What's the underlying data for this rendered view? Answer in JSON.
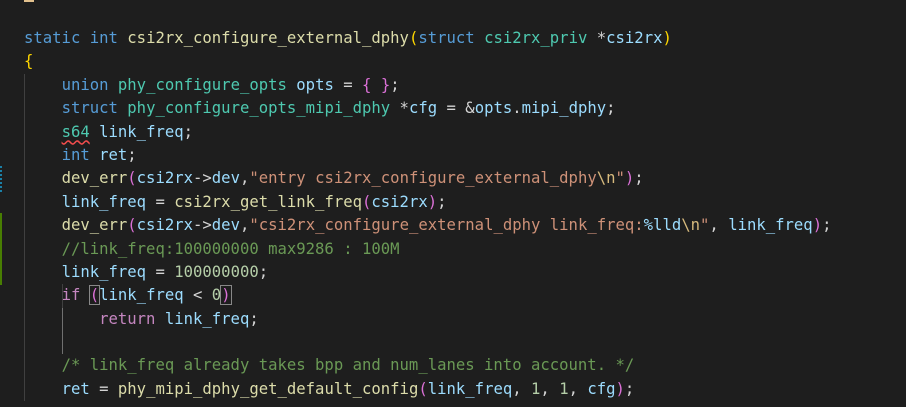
{
  "editor": {
    "lines": [
      [
        {
          "t": "static",
          "c": "kw"
        },
        {
          "t": " "
        },
        {
          "t": "int",
          "c": "kw"
        },
        {
          "t": " "
        },
        {
          "t": "csi2rx_configure_external_dphy",
          "c": "fn"
        },
        {
          "t": "(",
          "c": "bracket1"
        },
        {
          "t": "struct",
          "c": "kw"
        },
        {
          "t": " "
        },
        {
          "t": "csi2rx_priv",
          "c": "ty"
        },
        {
          "t": " *"
        },
        {
          "t": "csi2rx",
          "c": "var"
        },
        {
          "t": ")",
          "c": "bracket1"
        }
      ],
      [
        {
          "t": "{",
          "c": "bracket1"
        }
      ],
      [
        {
          "t": "    "
        },
        {
          "t": "union",
          "c": "kw"
        },
        {
          "t": " "
        },
        {
          "t": "phy_configure_opts",
          "c": "ty"
        },
        {
          "t": " "
        },
        {
          "t": "opts",
          "c": "var"
        },
        {
          "t": " = "
        },
        {
          "t": "{",
          "c": "bracket2"
        },
        {
          "t": " "
        },
        {
          "t": "}",
          "c": "bracket2"
        },
        {
          "t": ";"
        }
      ],
      [
        {
          "t": "    "
        },
        {
          "t": "struct",
          "c": "kw"
        },
        {
          "t": " "
        },
        {
          "t": "phy_configure_opts_mipi_dphy",
          "c": "ty"
        },
        {
          "t": " *"
        },
        {
          "t": "cfg",
          "c": "var"
        },
        {
          "t": " = &"
        },
        {
          "t": "opts",
          "c": "var"
        },
        {
          "t": "."
        },
        {
          "t": "mipi_dphy",
          "c": "var"
        },
        {
          "t": ";"
        }
      ],
      [
        {
          "t": "    "
        },
        {
          "t": "s64",
          "c": "ty squiggle"
        },
        {
          "t": " "
        },
        {
          "t": "link_freq",
          "c": "var"
        },
        {
          "t": ";"
        }
      ],
      [
        {
          "t": "    "
        },
        {
          "t": "int",
          "c": "kw"
        },
        {
          "t": " "
        },
        {
          "t": "ret",
          "c": "var"
        },
        {
          "t": ";"
        }
      ],
      [
        {
          "t": "    "
        },
        {
          "t": "dev_err",
          "c": "fn"
        },
        {
          "t": "(",
          "c": "bracket2"
        },
        {
          "t": "csi2rx",
          "c": "var"
        },
        {
          "t": "->"
        },
        {
          "t": "dev",
          "c": "var"
        },
        {
          "t": ","
        },
        {
          "t": "\"entry csi2rx_configure_external_dphy",
          "c": "str"
        },
        {
          "t": "\\n",
          "c": "esc"
        },
        {
          "t": "\"",
          "c": "str"
        },
        {
          "t": ")",
          "c": "bracket2"
        },
        {
          "t": ";"
        }
      ],
      [
        {
          "t": "    "
        },
        {
          "t": "link_freq",
          "c": "var"
        },
        {
          "t": " = "
        },
        {
          "t": "csi2rx_get_link_freq",
          "c": "fn"
        },
        {
          "t": "(",
          "c": "bracket2"
        },
        {
          "t": "csi2rx",
          "c": "var"
        },
        {
          "t": ")",
          "c": "bracket2"
        },
        {
          "t": ";"
        }
      ],
      [
        {
          "t": "    "
        },
        {
          "t": "dev_err",
          "c": "fn"
        },
        {
          "t": "(",
          "c": "bracket2"
        },
        {
          "t": "csi2rx",
          "c": "var"
        },
        {
          "t": "->"
        },
        {
          "t": "dev",
          "c": "var"
        },
        {
          "t": ","
        },
        {
          "t": "\"csi2rx_configure_external_dphy link_freq:",
          "c": "str"
        },
        {
          "t": "%lld",
          "c": "var"
        },
        {
          "t": "\\n",
          "c": "esc"
        },
        {
          "t": "\"",
          "c": "str"
        },
        {
          "t": ", "
        },
        {
          "t": "link_freq",
          "c": "var"
        },
        {
          "t": ")",
          "c": "bracket2"
        },
        {
          "t": ";"
        }
      ],
      [
        {
          "t": "    "
        },
        {
          "t": "//link_freq:100000000 max9286 : 100M",
          "c": "cm"
        }
      ],
      [
        {
          "t": "    "
        },
        {
          "t": "link_freq",
          "c": "var"
        },
        {
          "t": " = "
        },
        {
          "t": "100000000",
          "c": "num"
        },
        {
          "t": ";"
        }
      ],
      [
        {
          "t": "    "
        },
        {
          "t": "if",
          "c": "ctl"
        },
        {
          "t": " "
        },
        {
          "t": "(",
          "c": "bracket2 match-box"
        },
        {
          "t": "link_freq",
          "c": "var"
        },
        {
          "t": " < "
        },
        {
          "t": "0",
          "c": "num"
        },
        {
          "t": ")",
          "c": "bracket2 match-box"
        }
      ],
      [
        {
          "t": "        "
        },
        {
          "t": "return",
          "c": "ctl"
        },
        {
          "t": " "
        },
        {
          "t": "link_freq",
          "c": "var"
        },
        {
          "t": ";"
        }
      ],
      [
        {
          "t": ""
        }
      ],
      [
        {
          "t": "    "
        },
        {
          "t": "/* link_freq already takes bpp and num_lanes into account. */",
          "c": "cm"
        }
      ],
      [
        {
          "t": "    "
        },
        {
          "t": "ret",
          "c": "var"
        },
        {
          "t": " = "
        },
        {
          "t": "phy_mipi_dphy_get_default_config",
          "c": "fn"
        },
        {
          "t": "(",
          "c": "bracket2"
        },
        {
          "t": "link_freq",
          "c": "var"
        },
        {
          "t": ", "
        },
        {
          "t": "1",
          "c": "num"
        },
        {
          "t": ", "
        },
        {
          "t": "1",
          "c": "num"
        },
        {
          "t": ", "
        },
        {
          "t": "cfg",
          "c": "var"
        },
        {
          "t": ")",
          "c": "bracket2"
        },
        {
          "t": ";"
        }
      ]
    ],
    "indent_guides": {
      "outer_from_line": 2,
      "outer_to_line": 15,
      "inner_line": 12,
      "active_block_from": 11,
      "active_block_to": 13
    },
    "colors": {
      "background": "#1e1e1e",
      "modified_gutter": "#1b81a8",
      "added_gutter": "#487e02",
      "top_hint": "#e2c08d"
    }
  }
}
